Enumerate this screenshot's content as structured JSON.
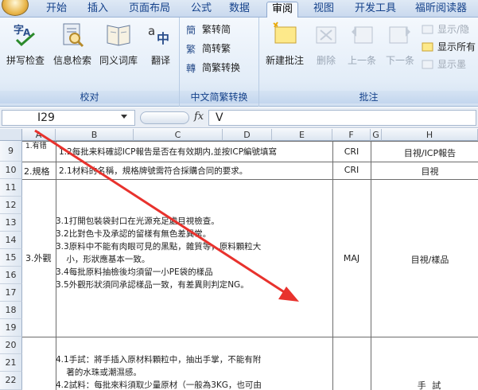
{
  "tabs": [
    "开始",
    "插入",
    "页面布局",
    "公式",
    "数据",
    "审阅",
    "视图",
    "开发工具",
    "福昕阅读器"
  ],
  "active_tab": "审阅",
  "ribbon": {
    "proofing": {
      "label": "校对",
      "buttons": [
        "拼写检查",
        "信息检索",
        "同义词库",
        "翻译"
      ]
    },
    "chinese": {
      "label": "中文简繁转换",
      "buttons": [
        "繁转简",
        "简转繁",
        "简繁转换"
      ]
    },
    "comments": {
      "label": "批注",
      "buttons": [
        "新建批注",
        "删除",
        "上一条",
        "下一条"
      ],
      "side_buttons": [
        "显示/隐",
        "显示所有",
        "显示墨"
      ]
    }
  },
  "formula_bar": {
    "name_box": "I29",
    "fx": "fx",
    "value": "V"
  },
  "columns": [
    "A",
    "B",
    "C",
    "D",
    "E",
    "F",
    "G",
    "H"
  ],
  "rows": [
    "9",
    "10",
    "11",
    "12",
    "13",
    "14",
    "15",
    "16",
    "17",
    "18",
    "19",
    "20",
    "21",
    "22"
  ],
  "cells": {
    "a9": "1.有错",
    "b9": "1.2每批来料確認ICP報告是否在有效期内,並按ICP編號填寫",
    "f9": "CRI",
    "h9": "目視/ICP報告",
    "a10": "2.規格",
    "b10": "2.1材料的名稱，規格牌號需符合採購合同的要求。",
    "f10": "CRI",
    "h10": "目視",
    "a15": "3.外觀",
    "f15": "MAJ",
    "h15": "目視/樣品",
    "h22": "手 試"
  },
  "appearance_lines": [
    "3.1打開包裝袋封口在光源充足處目視檢查。",
    "3.2比對色卡及承認的留樣有無色差異常。",
    "3.3原料中不能有肉眼可見的黑點，雜質等，原料顆粒大",
    "    小，形狀應基本一致。",
    "3.4每批原料抽檢後均須留一小PE袋的樣品",
    "3.5外觀形狀須同承認樣品一致，有差異則判定NG。"
  ],
  "handtest_lines": [
    "4.1手試：將手插入原材料顆粒中，抽出手掌，不能有附",
    "    著的水珠或潮濕感。",
    "4.2試料：每批來料須取少量原材（一般為3KG，也可由"
  ],
  "colors": {
    "accent": "#15428b",
    "annotation_arrow": "#e8322d"
  }
}
